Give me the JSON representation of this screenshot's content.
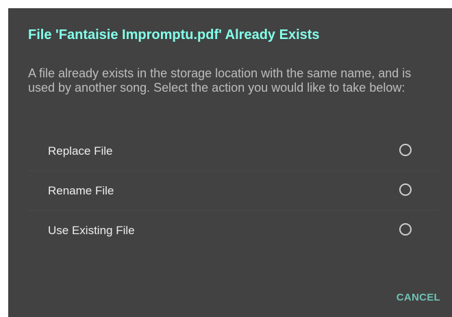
{
  "dialog": {
    "title": "File 'Fantaisie Impromptu.pdf' Already Exists",
    "message": "A file already exists in the storage location with the same name, and is used by another song. Select the action you would like to take below:",
    "options": [
      {
        "label": "Replace File",
        "selected": false
      },
      {
        "label": "Rename File",
        "selected": false
      },
      {
        "label": "Use Existing File",
        "selected": false
      }
    ],
    "cancel_label": "CANCEL"
  },
  "colors": {
    "dialog_background": "#424242",
    "title": "#84ffea",
    "message": "#bdbdbd",
    "option_text": "#eeeeee",
    "accent_button": "#6fc2b5"
  },
  "icons": [
    "radio-unchecked-icon"
  ]
}
